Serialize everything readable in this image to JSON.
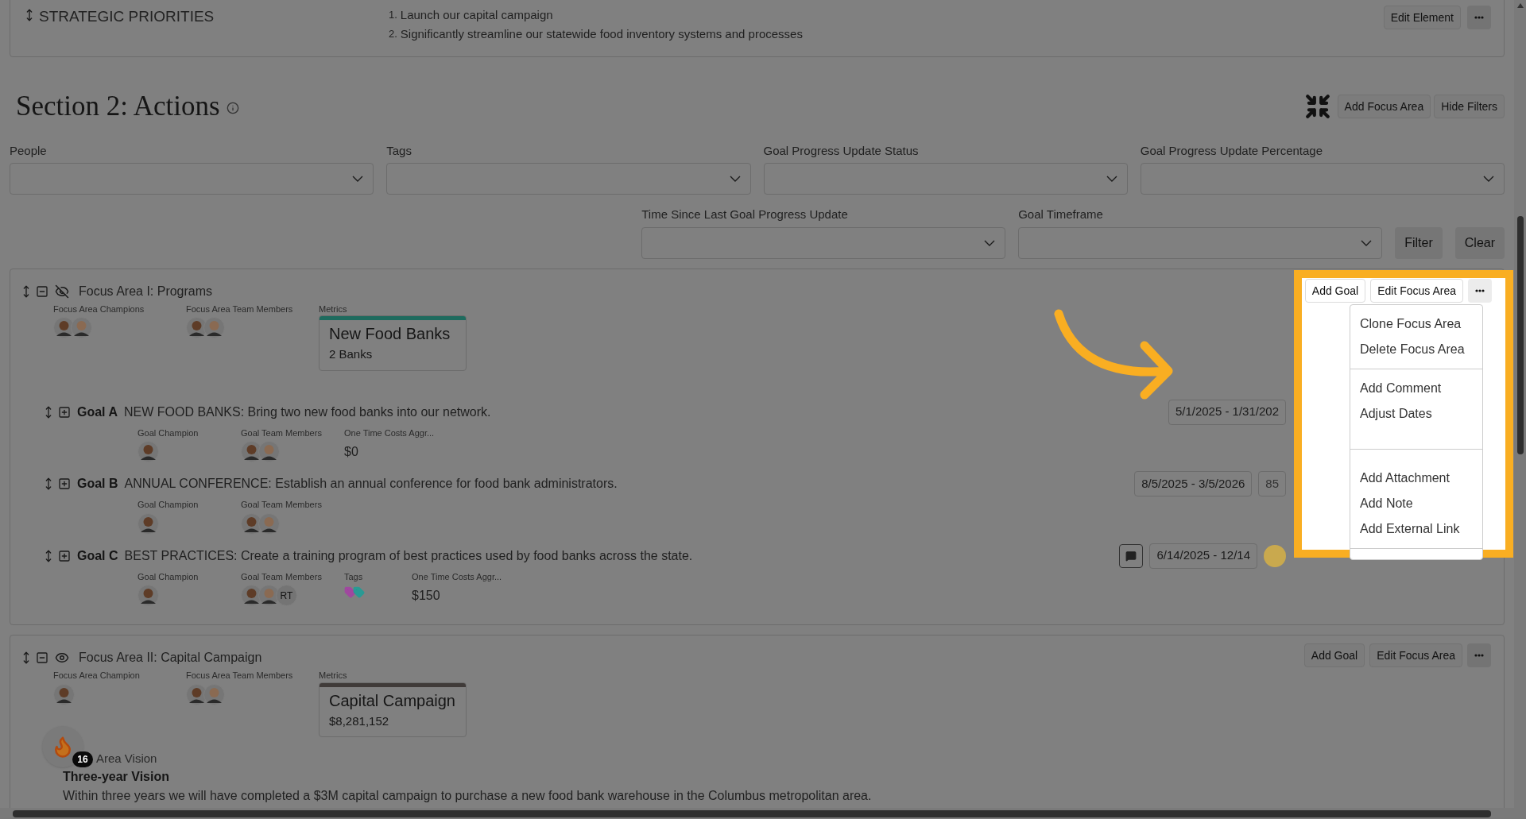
{
  "strategic_priorities": {
    "title": "STRATEGIC PRIORITIES",
    "items": [
      {
        "number": "1.",
        "text": "Launch our capital campaign"
      },
      {
        "number": "2.",
        "text": "Significantly streamline our statewide food inventory systems and processes"
      }
    ],
    "edit_button": "Edit Element"
  },
  "section": {
    "title": "Section 2: Actions",
    "buttons": [
      "Add Focus Area",
      "Hide Filters"
    ]
  },
  "filters": {
    "row_1": [
      {
        "label": "People"
      },
      {
        "label": "Tags"
      },
      {
        "label": "Goal Progress Update Status"
      },
      {
        "label": "Goal Progress Update Percentage"
      }
    ],
    "row_2": [
      {
        "label": "Time Since Last Goal Progress Update"
      },
      {
        "label": "Goal Timeframe"
      }
    ],
    "buttons": [
      "Filter",
      "Clear"
    ]
  },
  "focus_areas": [
    {
      "title": "Focus Area I: Programs",
      "visible": false,
      "expanded": true,
      "buttons": [
        "Add Goal",
        "Edit Focus Area"
      ],
      "people": [
        {
          "label": "Focus Area Champions",
          "avatars": [
            {
              "kind": "photo"
            },
            {
              "kind": "photo"
            }
          ]
        },
        {
          "label": "Focus Area Team Members",
          "avatars": [
            {
              "kind": "photo"
            },
            {
              "kind": "photo"
            }
          ]
        }
      ],
      "metric": {
        "label": "Metrics",
        "title": "New Food Banks",
        "value": "2 Banks",
        "color": "#1e6b5e"
      },
      "goals": [
        {
          "label": "Goal A",
          "title": "NEW FOOD BANKS: Bring two new food banks into our network.",
          "expanded": false,
          "has_comments": false,
          "dates": "5/1/2025 - 1/31/202",
          "fields": [
            {
              "kind": "people",
              "label": "Goal Champion",
              "avatars": [
                {
                  "kind": "photo"
                }
              ]
            },
            {
              "kind": "people",
              "label": "Goal Team Members",
              "avatars": [
                {
                  "kind": "photo"
                },
                {
                  "kind": "photo"
                }
              ]
            },
            {
              "kind": "value",
              "label": "One Time Costs Aggr...",
              "value": "$0"
            }
          ]
        },
        {
          "label": "Goal B",
          "title": "ANNUAL CONFERENCE: Establish an annual conference for food bank administrators.",
          "expanded": false,
          "has_comments": false,
          "dates": "8/5/2025 - 3/5/2026",
          "percent": "85",
          "fields": [
            {
              "kind": "people",
              "label": "Goal Champion",
              "avatars": [
                {
                  "kind": "photo"
                }
              ]
            },
            {
              "kind": "people",
              "label": "Goal Team Members",
              "avatars": [
                {
                  "kind": "photo"
                },
                {
                  "kind": "photo"
                }
              ]
            }
          ]
        },
        {
          "label": "Goal C",
          "title": "BEST PRACTICES: Create a training program of best practices used by food banks across the state.",
          "expanded": false,
          "has_comments": true,
          "dates": "6/14/2025 - 12/14",
          "color": "#c9a94e",
          "fields": [
            {
              "kind": "people",
              "label": "Goal Champion",
              "avatars": [
                {
                  "kind": "photo"
                }
              ]
            },
            {
              "kind": "people",
              "label": "Goal Team Members",
              "avatars": [
                {
                  "kind": "photo"
                },
                {
                  "kind": "photo"
                },
                {
                  "kind": "initials",
                  "initials": "RT"
                }
              ]
            },
            {
              "kind": "tags",
              "label": "Tags",
              "tags": [
                {
                  "color": "#a0489f"
                },
                {
                  "color": "#2a9a94"
                }
              ]
            },
            {
              "kind": "value",
              "label": "One Time Costs Aggr...",
              "value": "$150"
            }
          ]
        }
      ]
    },
    {
      "title": "Focus Area II: Capital Campaign",
      "visible": true,
      "expanded": true,
      "buttons": [
        "Add Goal",
        "Edit Focus Area"
      ],
      "people": [
        {
          "label": "Focus Area Champion",
          "avatars": [
            {
              "kind": "photo"
            }
          ]
        },
        {
          "label": "Focus Area Team Members",
          "avatars": [
            {
              "kind": "photo"
            },
            {
              "kind": "photo"
            }
          ]
        }
      ],
      "metric": {
        "label": "Metrics",
        "title": "Capital Campaign",
        "value": "$8,281,152",
        "color": "#403b39"
      },
      "vision": {
        "badge": "16",
        "label": "Area Vision",
        "title": "Three-year Vision",
        "text": "Within three years we will have completed a $3M capital campaign to purchase a new food bank warehouse in the Columbus metropolitan area."
      }
    }
  ],
  "menu": {
    "groups": [
      [
        "Clone Focus Area",
        "Delete Focus Area"
      ],
      [
        "Add Comment",
        "Adjust Dates"
      ],
      [
        "Add Attachment",
        "Add Note",
        "Add External Link"
      ]
    ]
  }
}
